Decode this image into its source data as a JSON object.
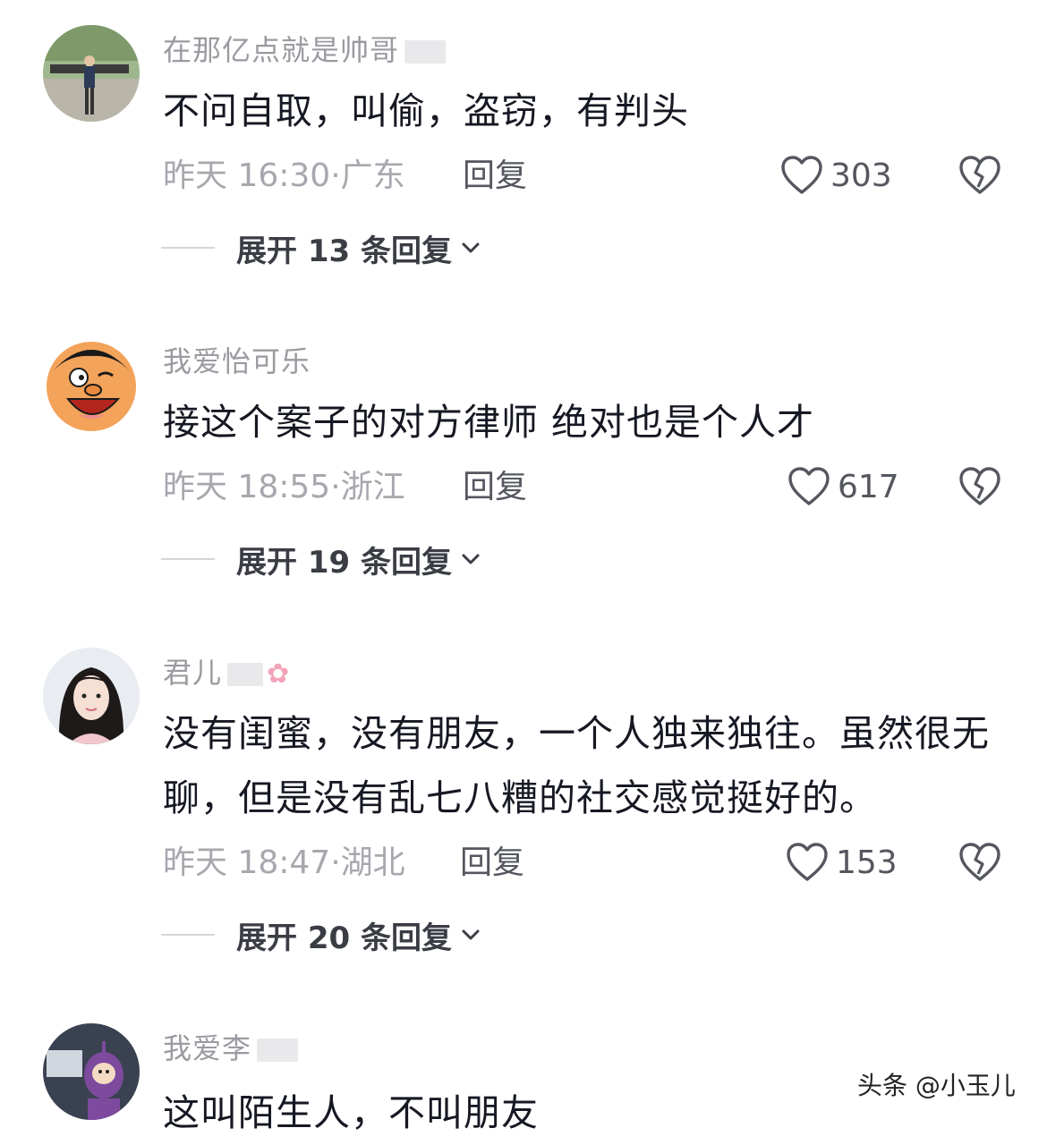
{
  "comments": [
    {
      "username": "在那亿点就是帅哥",
      "text": "不问自取，叫偷，盗窃，有判头",
      "time": "昨天 16:30",
      "location": "广东",
      "reply_label": "回复",
      "likes": "303",
      "expand_label": "展开 13 条回复"
    },
    {
      "username": "我爱怡可乐",
      "text": "接这个案子的对方律师 绝对也是个人才",
      "time": "昨天 18:55",
      "location": "浙江",
      "reply_label": "回复",
      "likes": "617",
      "expand_label": "展开 19 条回复"
    },
    {
      "username": "君儿",
      "text": "没有闺蜜，没有朋友，一个人独来独往。虽然很无聊，但是没有乱七八糟的社交感觉挺好的。",
      "time": "昨天 18:47",
      "location": "湖北",
      "reply_label": "回复",
      "likes": "153",
      "expand_label": "展开 20 条回复"
    },
    {
      "username": "我爱李",
      "text": "这叫陌生人，不叫朋友"
    }
  ],
  "meta_separator": "·",
  "watermark": "头条 @小玉儿",
  "icons": {
    "like": "heart-outline-icon",
    "dislike": "broken-heart-icon",
    "expand": "chevron-down-icon"
  },
  "colors": {
    "text": "#161823",
    "muted": "#a7a8ae",
    "action": "#55575f"
  }
}
